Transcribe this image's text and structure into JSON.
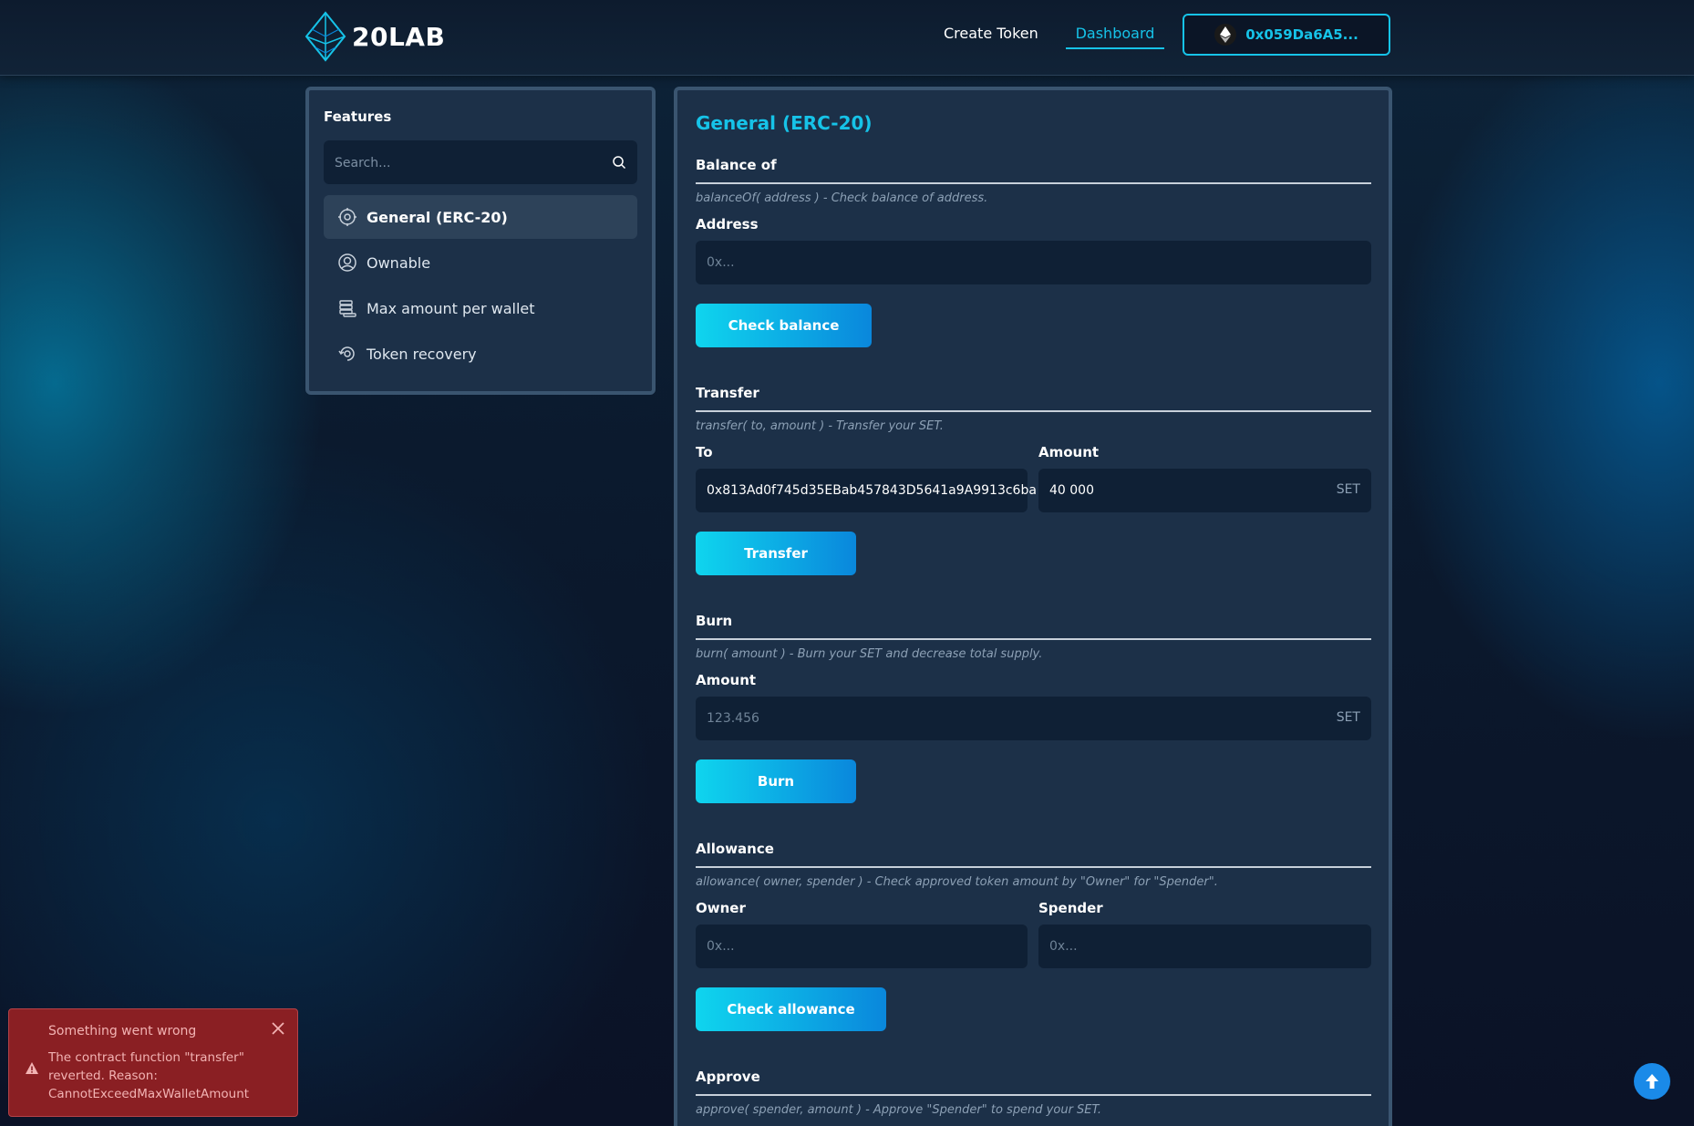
{
  "header": {
    "logo_text": "20LAB",
    "nav": {
      "create_token": "Create Token",
      "dashboard": "Dashboard"
    },
    "wallet_address": "0x059Da6A5..."
  },
  "sidebar": {
    "title": "Features",
    "search_placeholder": "Search...",
    "items": [
      {
        "label": "General (ERC-20)",
        "icon": "chip-icon",
        "active": true
      },
      {
        "label": "Ownable",
        "icon": "user-circle-icon",
        "active": false
      },
      {
        "label": "Max amount per wallet",
        "icon": "coins-stack-icon",
        "active": false
      },
      {
        "label": "Token recovery",
        "icon": "recovery-icon",
        "active": false
      }
    ]
  },
  "main": {
    "title": "General (ERC-20)",
    "balance": {
      "title": "Balance of",
      "desc": "balanceOf( address ) - Check balance of address.",
      "address_label": "Address",
      "address_placeholder": "0x...",
      "button": "Check balance"
    },
    "transfer": {
      "title": "Transfer",
      "desc": "transfer( to, amount ) - Transfer your SET.",
      "to_label": "To",
      "to_value": "0x813Ad0f745d35EBab457843D5641a9A9913c6ba",
      "amount_label": "Amount",
      "amount_value": "40 000",
      "amount_suffix": "SET",
      "button": "Transfer"
    },
    "burn": {
      "title": "Burn",
      "desc": "burn( amount ) - Burn your SET and decrease total supply.",
      "amount_label": "Amount",
      "amount_placeholder": "123.456",
      "amount_suffix": "SET",
      "button": "Burn"
    },
    "allowance": {
      "title": "Allowance",
      "desc": "allowance( owner, spender ) - Check approved token amount by \"Owner\" for \"Spender\".",
      "owner_label": "Owner",
      "owner_placeholder": "0x...",
      "spender_label": "Spender",
      "spender_placeholder": "0x...",
      "button": "Check allowance"
    },
    "approve": {
      "title": "Approve",
      "desc": "approve( spender, amount ) - Approve \"Spender\" to spend your SET."
    }
  },
  "toast": {
    "title": "Something went wrong",
    "message": "The contract function \"transfer\" reverted. Reason: CannotExceedMaxWalletAmount"
  },
  "colors": {
    "accent": "#16c3e8",
    "panel": "#1c3048",
    "input_bg": "#0f2035",
    "error_bg": "#8a1f23"
  }
}
